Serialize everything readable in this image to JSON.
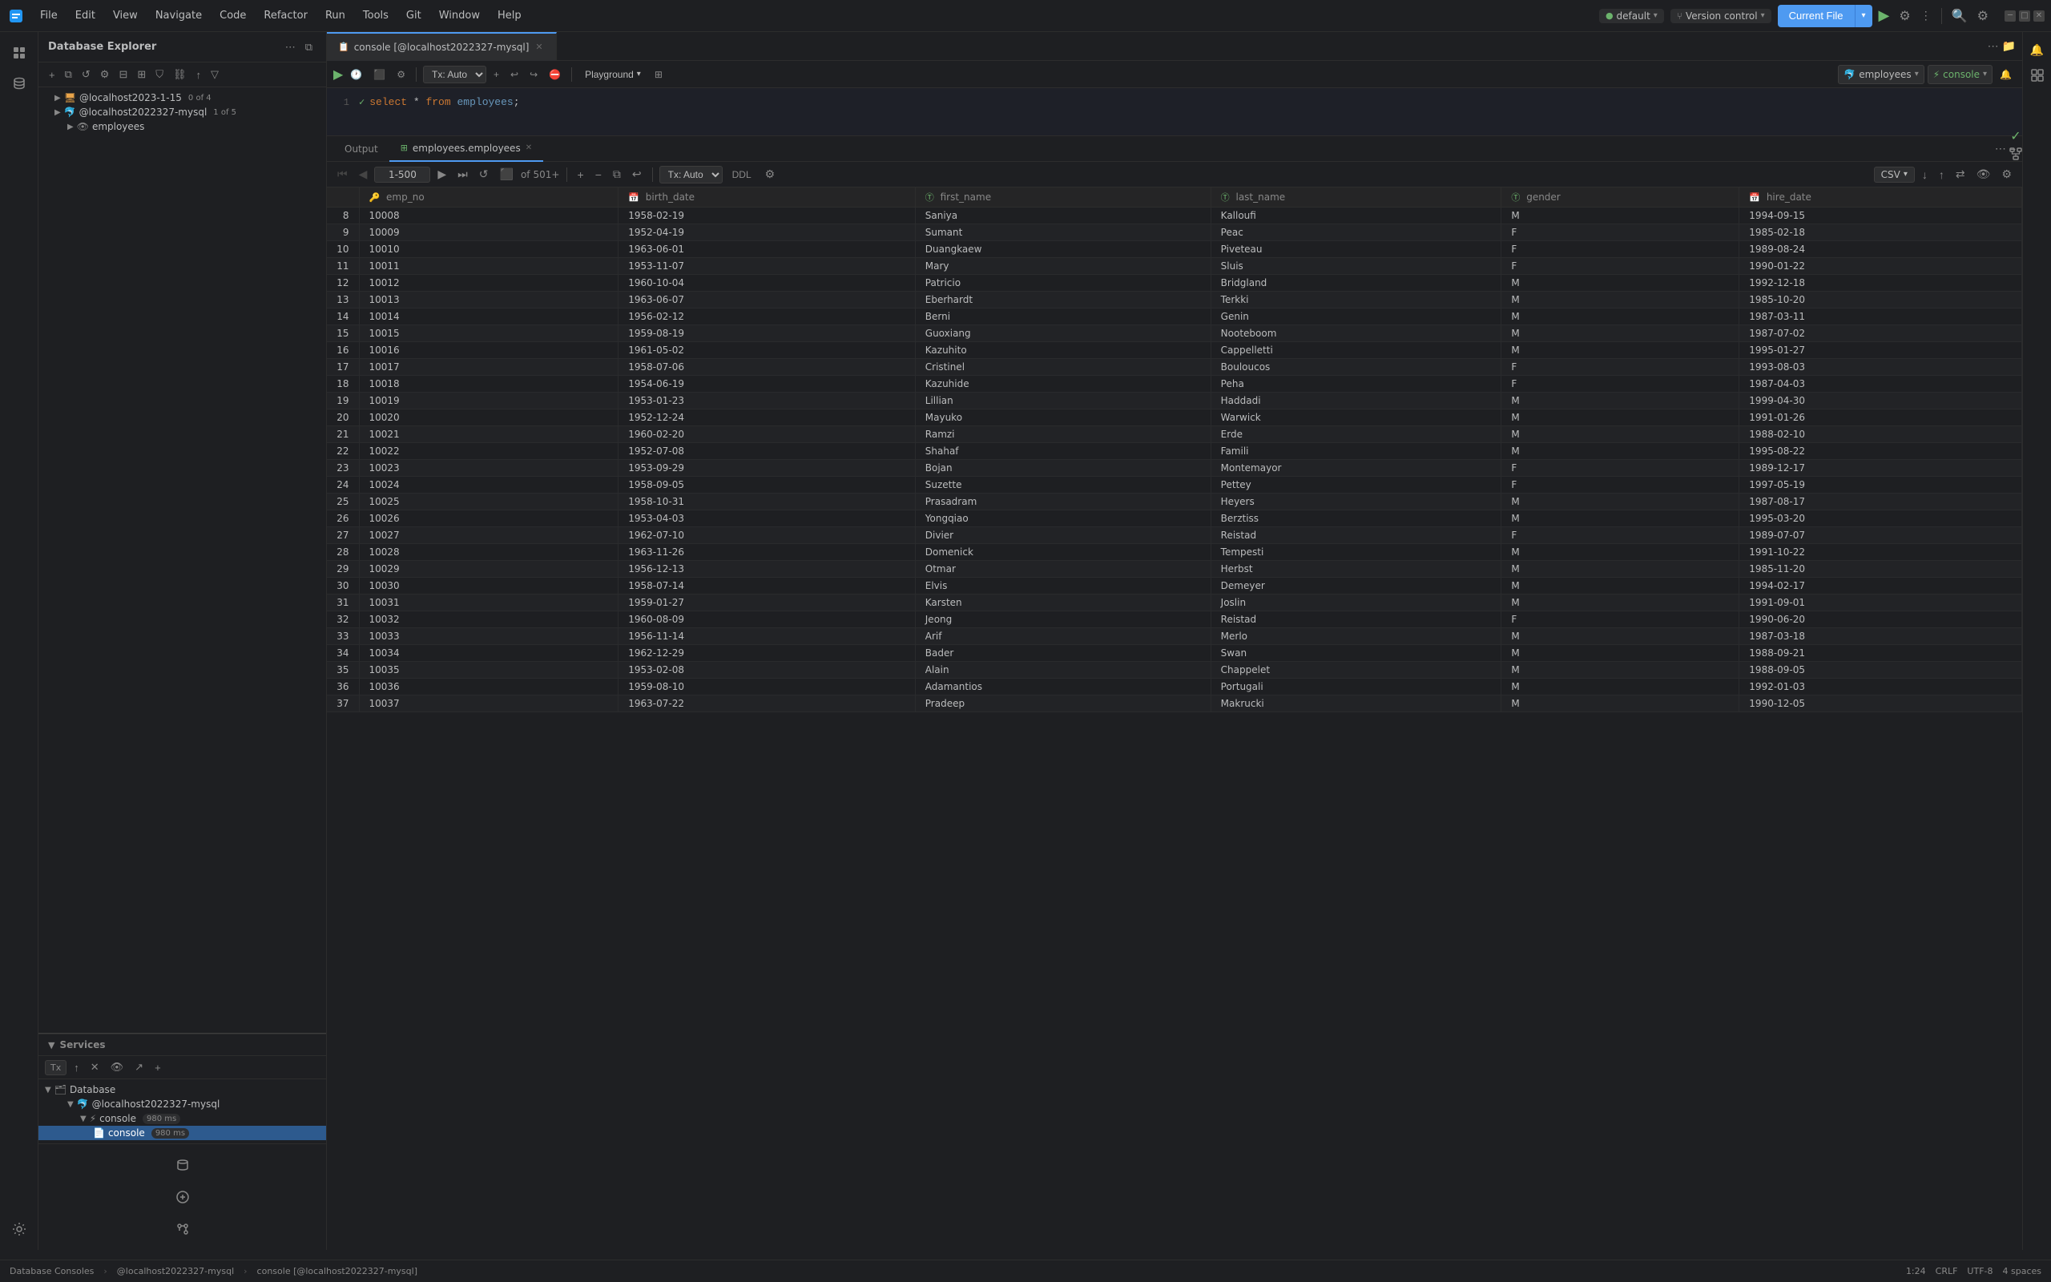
{
  "titleBar": {
    "menuItems": [
      "File",
      "Edit",
      "View",
      "Navigate",
      "Code",
      "Refactor",
      "Run",
      "Tools",
      "Git",
      "Window",
      "Help"
    ],
    "logo": "🗄"
  },
  "topToolbar": {
    "defaultLabel": "default",
    "versionControlLabel": "Version control",
    "currentFileLabel": "Current File",
    "runIcon": "▶",
    "gearIcon": "⚙",
    "bellIcon": "🔔"
  },
  "sidebar": {
    "title": "Database Explorer",
    "connections": [
      {
        "id": "conn1",
        "name": "@localhost2023-1-15",
        "count": "0 of 4",
        "expanded": true
      },
      {
        "id": "conn2",
        "name": "@localhost2022327-mysql",
        "count": "1 of 5",
        "expanded": true,
        "children": [
          {
            "name": "employees",
            "expanded": false
          }
        ]
      }
    ]
  },
  "services": {
    "title": "Services",
    "txLabel": "Tx",
    "tree": {
      "database": {
        "name": "Database",
        "children": [
          {
            "name": "@localhost2022327-mysql",
            "children": [
              {
                "name": "console",
                "ms": "980 ms",
                "children": [
                  {
                    "name": "console",
                    "ms": "980 ms",
                    "active": true
                  }
                ]
              }
            ]
          }
        ]
      }
    }
  },
  "editor": {
    "tabLabel": "console [@localhost2022327-mysql]",
    "playgroundLabel": "Playground",
    "txAutoLabel": "Tx: Auto",
    "query": "select * from employees;",
    "lineNumber": "1",
    "connSelect": "employees",
    "schemaSelect": "console"
  },
  "results": {
    "outputTab": "Output",
    "dataTab": "employees.employees",
    "pageRange": "1-500",
    "total": "501+",
    "txAuto": "Tx: Auto",
    "ddlLabel": "DDL",
    "csvLabel": "CSV",
    "columns": [
      "emp_no",
      "birth_date",
      "first_name",
      "last_name",
      "gender",
      "hire_date"
    ],
    "rows": [
      {
        "num": 8,
        "emp_no": "10008",
        "birth_date": "1958-02-19",
        "first_name": "Saniya",
        "last_name": "Kalloufi",
        "gender": "M",
        "hire_date": "1994-09-15"
      },
      {
        "num": 9,
        "emp_no": "10009",
        "birth_date": "1952-04-19",
        "first_name": "Sumant",
        "last_name": "Peac",
        "gender": "F",
        "hire_date": "1985-02-18"
      },
      {
        "num": 10,
        "emp_no": "10010",
        "birth_date": "1963-06-01",
        "first_name": "Duangkaew",
        "last_name": "Piveteau",
        "gender": "F",
        "hire_date": "1989-08-24"
      },
      {
        "num": 11,
        "emp_no": "10011",
        "birth_date": "1953-11-07",
        "first_name": "Mary",
        "last_name": "Sluis",
        "gender": "F",
        "hire_date": "1990-01-22"
      },
      {
        "num": 12,
        "emp_no": "10012",
        "birth_date": "1960-10-04",
        "first_name": "Patricio",
        "last_name": "Bridgland",
        "gender": "M",
        "hire_date": "1992-12-18"
      },
      {
        "num": 13,
        "emp_no": "10013",
        "birth_date": "1963-06-07",
        "first_name": "Eberhardt",
        "last_name": "Terkki",
        "gender": "M",
        "hire_date": "1985-10-20"
      },
      {
        "num": 14,
        "emp_no": "10014",
        "birth_date": "1956-02-12",
        "first_name": "Berni",
        "last_name": "Genin",
        "gender": "M",
        "hire_date": "1987-03-11"
      },
      {
        "num": 15,
        "emp_no": "10015",
        "birth_date": "1959-08-19",
        "first_name": "Guoxiang",
        "last_name": "Nooteboom",
        "gender": "M",
        "hire_date": "1987-07-02"
      },
      {
        "num": 16,
        "emp_no": "10016",
        "birth_date": "1961-05-02",
        "first_name": "Kazuhito",
        "last_name": "Cappelletti",
        "gender": "M",
        "hire_date": "1995-01-27"
      },
      {
        "num": 17,
        "emp_no": "10017",
        "birth_date": "1958-07-06",
        "first_name": "Cristinel",
        "last_name": "Bouloucos",
        "gender": "F",
        "hire_date": "1993-08-03"
      },
      {
        "num": 18,
        "emp_no": "10018",
        "birth_date": "1954-06-19",
        "first_name": "Kazuhide",
        "last_name": "Peha",
        "gender": "F",
        "hire_date": "1987-04-03"
      },
      {
        "num": 19,
        "emp_no": "10019",
        "birth_date": "1953-01-23",
        "first_name": "Lillian",
        "last_name": "Haddadi",
        "gender": "M",
        "hire_date": "1999-04-30"
      },
      {
        "num": 20,
        "emp_no": "10020",
        "birth_date": "1952-12-24",
        "first_name": "Mayuko",
        "last_name": "Warwick",
        "gender": "M",
        "hire_date": "1991-01-26"
      },
      {
        "num": 21,
        "emp_no": "10021",
        "birth_date": "1960-02-20",
        "first_name": "Ramzi",
        "last_name": "Erde",
        "gender": "M",
        "hire_date": "1988-02-10"
      },
      {
        "num": 22,
        "emp_no": "10022",
        "birth_date": "1952-07-08",
        "first_name": "Shahaf",
        "last_name": "Famili",
        "gender": "M",
        "hire_date": "1995-08-22"
      },
      {
        "num": 23,
        "emp_no": "10023",
        "birth_date": "1953-09-29",
        "first_name": "Bojan",
        "last_name": "Montemayor",
        "gender": "F",
        "hire_date": "1989-12-17"
      },
      {
        "num": 24,
        "emp_no": "10024",
        "birth_date": "1958-09-05",
        "first_name": "Suzette",
        "last_name": "Pettey",
        "gender": "F",
        "hire_date": "1997-05-19"
      },
      {
        "num": 25,
        "emp_no": "10025",
        "birth_date": "1958-10-31",
        "first_name": "Prasadram",
        "last_name": "Heyers",
        "gender": "M",
        "hire_date": "1987-08-17"
      },
      {
        "num": 26,
        "emp_no": "10026",
        "birth_date": "1953-04-03",
        "first_name": "Yongqiao",
        "last_name": "Berztiss",
        "gender": "M",
        "hire_date": "1995-03-20"
      },
      {
        "num": 27,
        "emp_no": "10027",
        "birth_date": "1962-07-10",
        "first_name": "Divier",
        "last_name": "Reistad",
        "gender": "F",
        "hire_date": "1989-07-07"
      },
      {
        "num": 28,
        "emp_no": "10028",
        "birth_date": "1963-11-26",
        "first_name": "Domenick",
        "last_name": "Tempesti",
        "gender": "M",
        "hire_date": "1991-10-22"
      },
      {
        "num": 29,
        "emp_no": "10029",
        "birth_date": "1956-12-13",
        "first_name": "Otmar",
        "last_name": "Herbst",
        "gender": "M",
        "hire_date": "1985-11-20"
      },
      {
        "num": 30,
        "emp_no": "10030",
        "birth_date": "1958-07-14",
        "first_name": "Elvis",
        "last_name": "Demeyer",
        "gender": "M",
        "hire_date": "1994-02-17"
      },
      {
        "num": 31,
        "emp_no": "10031",
        "birth_date": "1959-01-27",
        "first_name": "Karsten",
        "last_name": "Joslin",
        "gender": "M",
        "hire_date": "1991-09-01"
      },
      {
        "num": 32,
        "emp_no": "10032",
        "birth_date": "1960-08-09",
        "first_name": "Jeong",
        "last_name": "Reistad",
        "gender": "F",
        "hire_date": "1990-06-20"
      },
      {
        "num": 33,
        "emp_no": "10033",
        "birth_date": "1956-11-14",
        "first_name": "Arif",
        "last_name": "Merlo",
        "gender": "M",
        "hire_date": "1987-03-18"
      },
      {
        "num": 34,
        "emp_no": "10034",
        "birth_date": "1962-12-29",
        "first_name": "Bader",
        "last_name": "Swan",
        "gender": "M",
        "hire_date": "1988-09-21"
      },
      {
        "num": 35,
        "emp_no": "10035",
        "birth_date": "1953-02-08",
        "first_name": "Alain",
        "last_name": "Chappelet",
        "gender": "M",
        "hire_date": "1988-09-05"
      },
      {
        "num": 36,
        "emp_no": "10036",
        "birth_date": "1959-08-10",
        "first_name": "Adamantios",
        "last_name": "Portugali",
        "gender": "M",
        "hire_date": "1992-01-03"
      },
      {
        "num": 37,
        "emp_no": "10037",
        "birth_date": "1963-07-22",
        "first_name": "Pradeep",
        "last_name": "Makrucki",
        "gender": "M",
        "hire_date": "1990-12-05"
      }
    ]
  },
  "statusBar": {
    "breadcrumb1": "Database Consoles",
    "breadcrumb2": "@localhost2022327-mysql",
    "breadcrumb3": "console [@localhost2022327-mysql]",
    "position": "1:24",
    "lineEnding": "CRLF",
    "encoding": "UTF-8",
    "indent": "4 spaces"
  },
  "activityBar": {
    "icons": [
      "≡",
      "⊙",
      "⚡",
      "🔌"
    ]
  }
}
